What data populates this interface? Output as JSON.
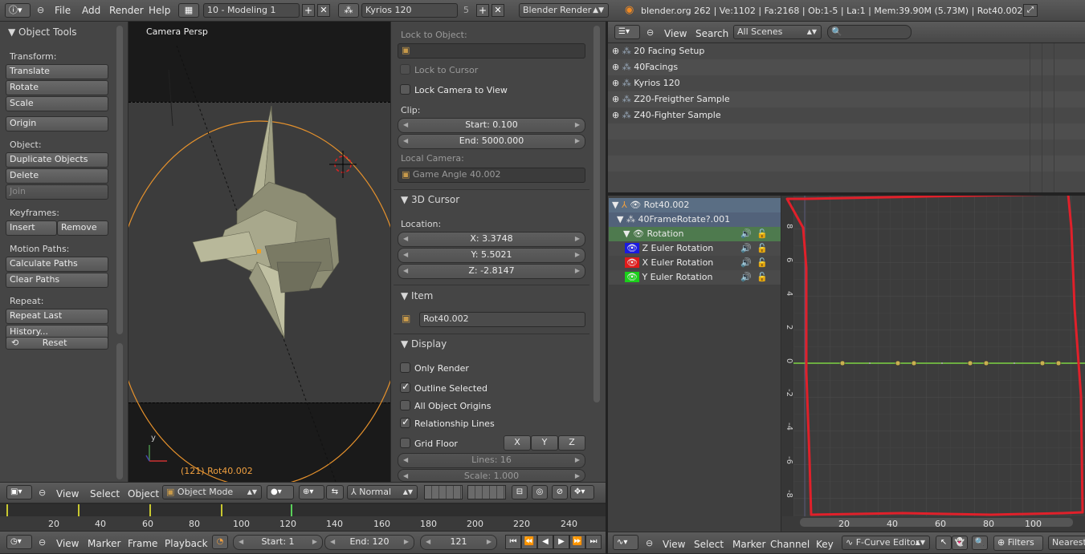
{
  "top_header": {
    "menus": [
      "File",
      "Add",
      "Render",
      "Help"
    ],
    "screen_layout": "10 - Modeling 1",
    "scene_name": "Kyrios 120",
    "scene_count": "5",
    "render_engine": "Blender Render",
    "stats": "blender.org 262 | Ve:1102 | Fa:2168 | Ob:1-5 | La:1 | Mem:39.90M (5.73M) | Rot40.002"
  },
  "object_tools": {
    "title": "Object Tools",
    "transform_label": "Transform:",
    "translate": "Translate",
    "rotate": "Rotate",
    "scale": "Scale",
    "origin": "Origin",
    "object_label": "Object:",
    "duplicate": "Duplicate Objects",
    "delete": "Delete",
    "join": "Join",
    "keyframes_label": "Keyframes:",
    "insert": "Insert",
    "remove": "Remove",
    "motion_paths_label": "Motion Paths:",
    "calculate_paths": "Calculate Paths",
    "clear_paths": "Clear Paths",
    "repeat_label": "Repeat:",
    "repeat_last": "Repeat Last",
    "history": "History...",
    "reset": "Reset"
  },
  "viewport": {
    "label": "Camera Persp",
    "object_info": "(121) Rot40.002",
    "axis_y": "y"
  },
  "properties": {
    "lock_to_object": "Lock to Object:",
    "lock_to_cursor": "Lock to Cursor",
    "lock_camera_to_view": "Lock Camera to View",
    "clip_label": "Clip:",
    "clip_start": "Start: 0.100",
    "clip_end": "End: 5000.000",
    "local_camera": "Local Camera:",
    "local_camera_value": "Game Angle 40.002",
    "cursor_panel": "3D Cursor",
    "location_label": "Location:",
    "loc_x": "X: 3.3748",
    "loc_y": "Y: 5.5021",
    "loc_z": "Z: -2.8147",
    "item_panel": "Item",
    "item_name": "Rot40.002",
    "display_panel": "Display",
    "only_render": "Only Render",
    "outline_selected": "Outline Selected",
    "all_object_origins": "All Object Origins",
    "relationship_lines": "Relationship Lines",
    "grid_floor": "Grid Floor",
    "axis_x": "X",
    "axis_y": "Y",
    "axis_z": "Z",
    "lines": "Lines: 16",
    "scale": "Scale: 1.000"
  },
  "view3d_header": {
    "view": "View",
    "select": "Select",
    "object": "Object",
    "mode": "Object Mode",
    "orientation": "Normal"
  },
  "timeline": {
    "ticks": [
      "20",
      "40",
      "60",
      "80",
      "100",
      "120",
      "140",
      "160",
      "180",
      "200",
      "220",
      "240"
    ],
    "view": "View",
    "marker": "Marker",
    "frame": "Frame",
    "playback": "Playback",
    "start": "Start: 1",
    "end": "End: 120",
    "current": "121"
  },
  "outliner": {
    "view": "View",
    "search": "Search",
    "filter": "All Scenes",
    "items": [
      "20 Facing Setup",
      "40Facings",
      "Kyrios 120",
      "Z20-Freigther Sample",
      "Z40-Fighter Sample"
    ]
  },
  "graph_editor": {
    "channels": {
      "object": "Rot40.002",
      "action": "40FrameRotate?.001",
      "group": "Rotation",
      "curves": [
        "Z Euler Rotation",
        "X Euler Rotation",
        "Y Euler Rotation"
      ]
    },
    "y_ticks": [
      "8",
      "6",
      "4",
      "2",
      "0",
      "-2",
      "-4",
      "-6",
      "-8"
    ],
    "x_ticks": [
      "20",
      "40",
      "60",
      "80",
      "100"
    ],
    "header": {
      "view": "View",
      "select": "Select",
      "marker": "Marker",
      "channel": "Channel",
      "key": "Key",
      "mode": "F-Curve Editor",
      "filters": "Filters",
      "interp": "Nearest"
    },
    "colors": {
      "z": "#1a1ae0",
      "x": "#e01a1a",
      "y": "#1ad01a",
      "annotation": "#e0202a"
    }
  }
}
